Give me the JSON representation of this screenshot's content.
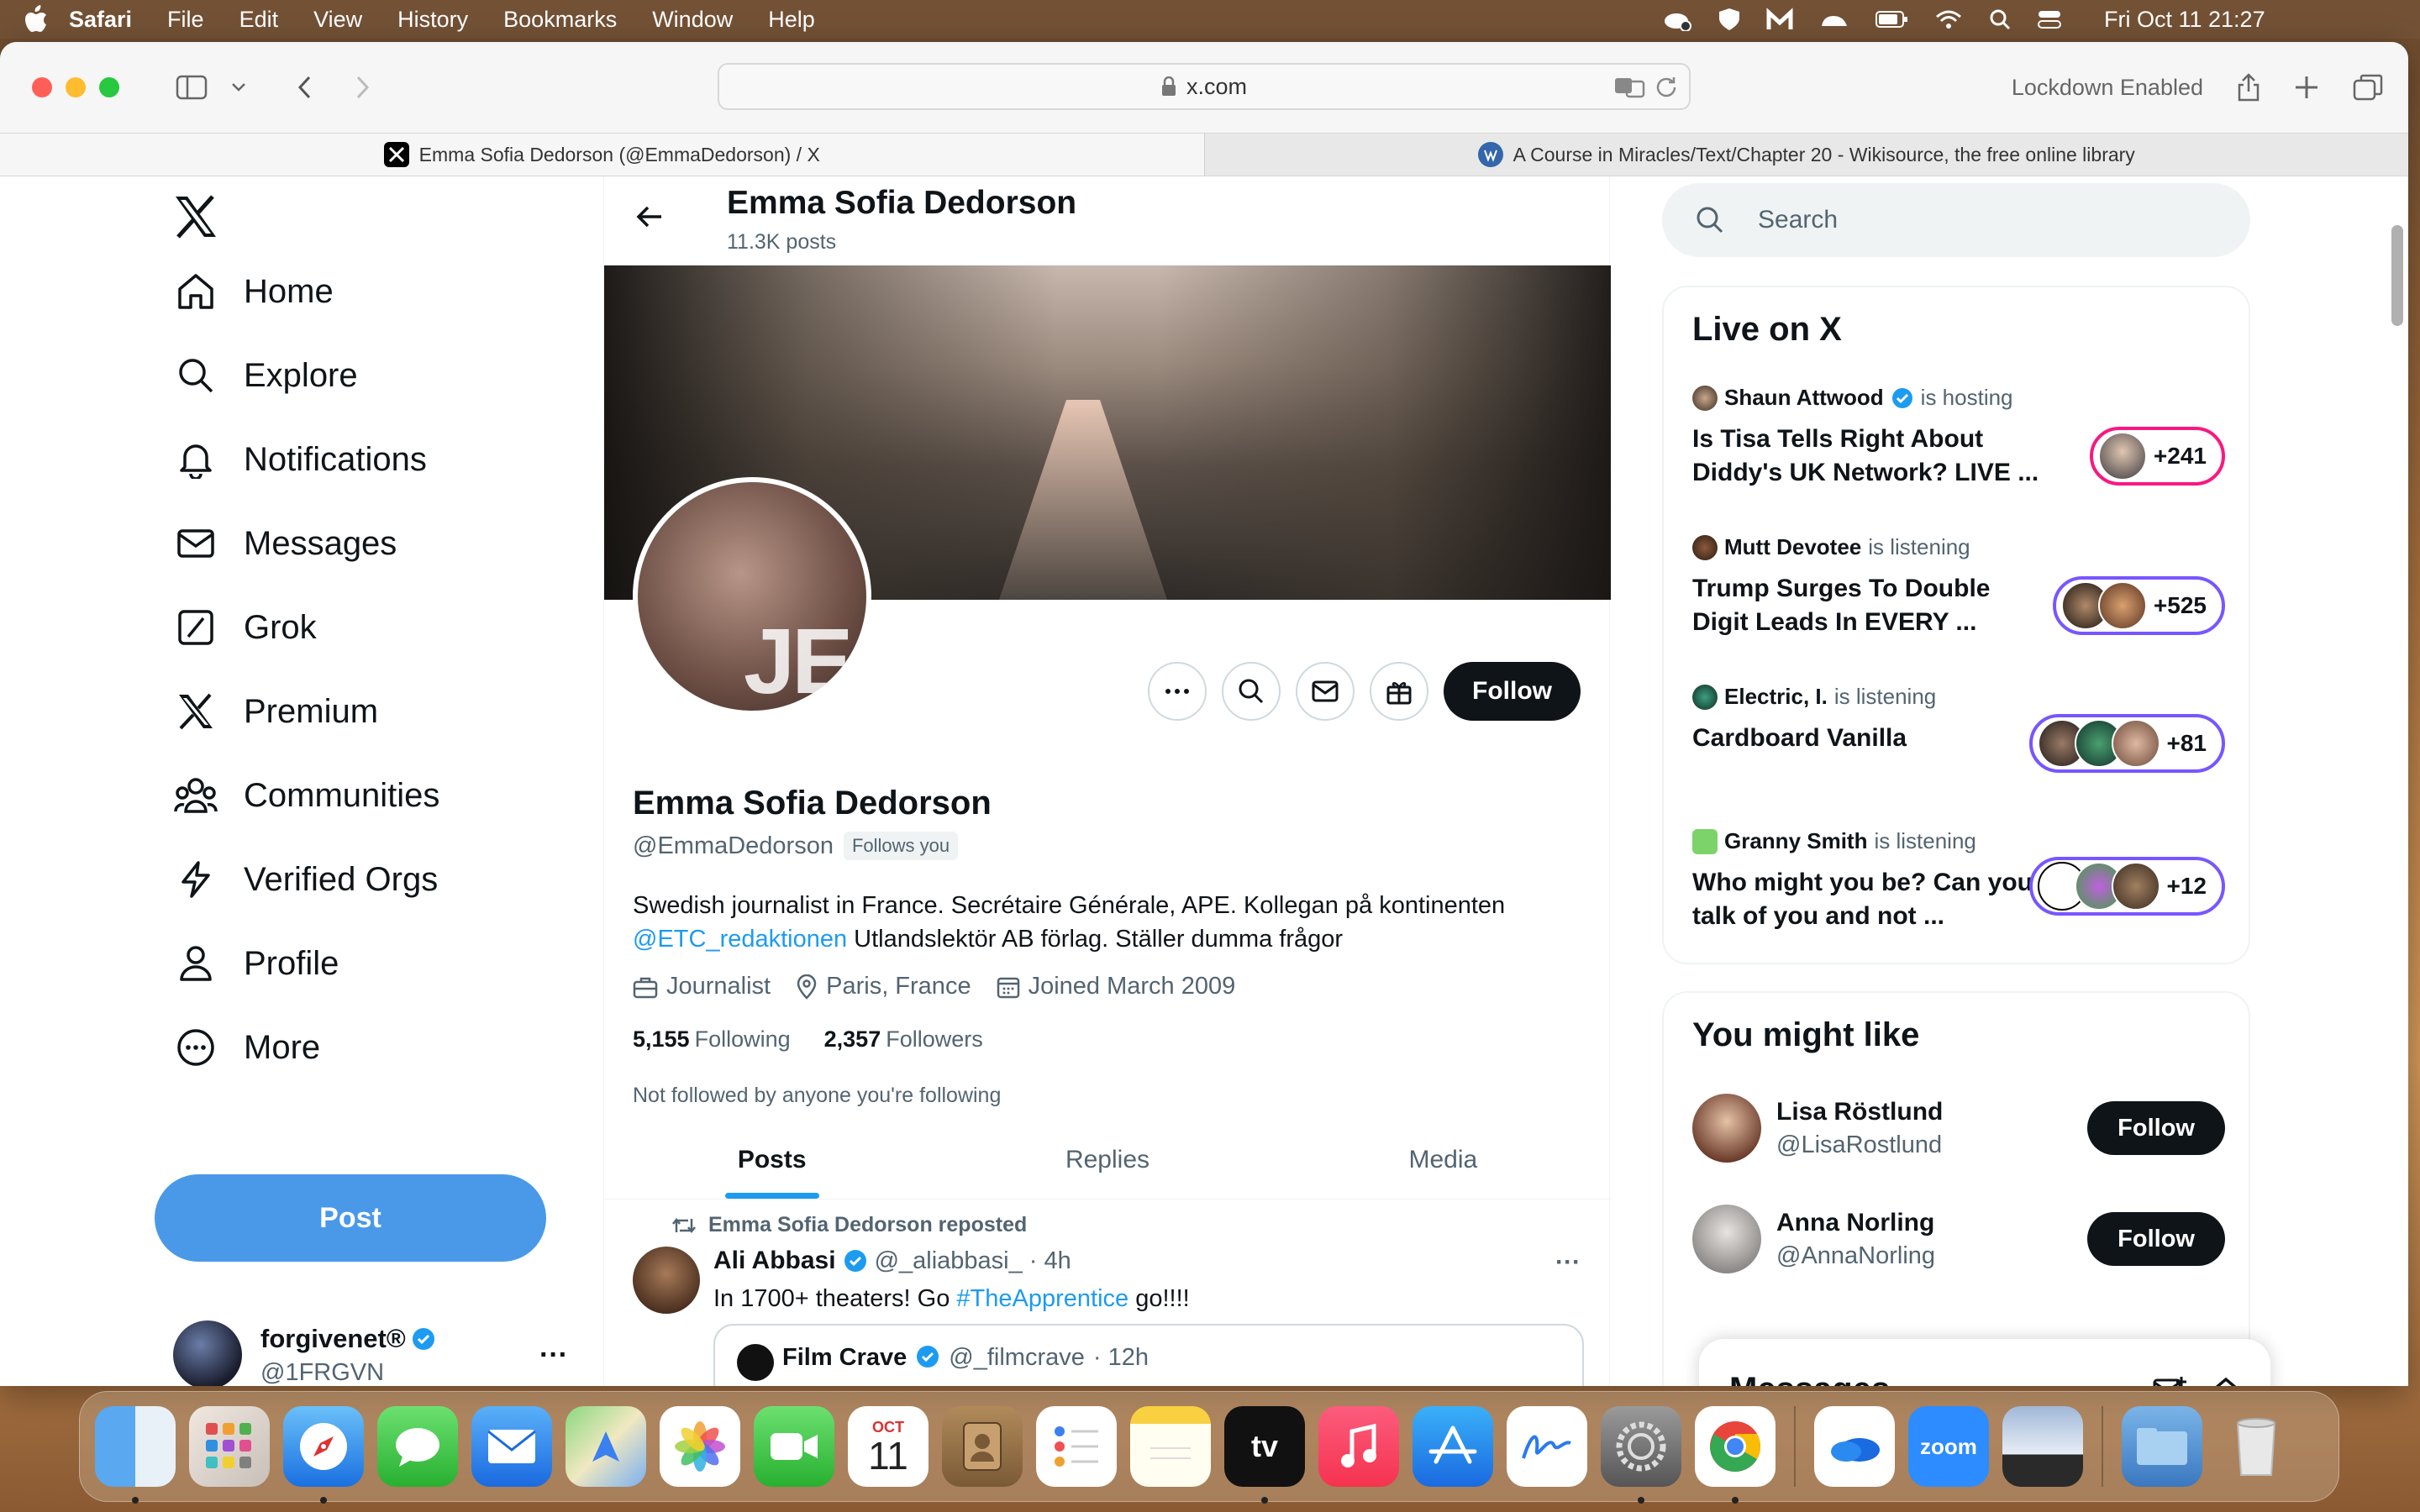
{
  "menubar": {
    "app": "Safari",
    "items": [
      "File",
      "Edit",
      "View",
      "History",
      "Bookmarks",
      "Window",
      "Help"
    ],
    "clock": "Fri Oct 11  21:27"
  },
  "browser": {
    "url": "x.com",
    "lockdown": "Lockdown Enabled",
    "tabs": [
      {
        "title": "Emma Sofia Dedorson (@EmmaDedorson) / X",
        "icon": "x-logo-icon",
        "active": true
      },
      {
        "title": "A Course in Miracles/Text/Chapter 20 - Wikisource, the free online library",
        "icon": "wikisource-icon",
        "active": false
      }
    ]
  },
  "nav": {
    "items": [
      {
        "label": "Home",
        "icon": "home-icon"
      },
      {
        "label": "Explore",
        "icon": "search-icon"
      },
      {
        "label": "Notifications",
        "icon": "bell-icon"
      },
      {
        "label": "Messages",
        "icon": "envelope-icon"
      },
      {
        "label": "Grok",
        "icon": "grok-icon"
      },
      {
        "label": "Premium",
        "icon": "x-logo-icon"
      },
      {
        "label": "Communities",
        "icon": "people-icon"
      },
      {
        "label": "Verified Orgs",
        "icon": "lightning-icon"
      },
      {
        "label": "Profile",
        "icon": "person-icon"
      },
      {
        "label": "More",
        "icon": "more-circle-icon"
      }
    ],
    "post_label": "Post",
    "account": {
      "name": "forgivenet®",
      "handle": "@1FRGVN"
    }
  },
  "profile": {
    "header_name": "Emma Sofia Dedorson",
    "post_count": "11.3K posts",
    "pic_text": "JE",
    "name": "Emma Sofia Dedorson",
    "handle": "@EmmaDedorson",
    "follows_you": "Follows you",
    "follow_label": "Follow",
    "bio_line1": "Swedish journalist in France. Secrétaire Générale, APE. Kollegan på kontinenten",
    "bio_link": "@ETC_redaktionen",
    "bio_line2": " Utlandslektör AB förlag. Ställer dumma frågor",
    "job": "Journalist",
    "location": "Paris, France",
    "joined": "Joined March 2009",
    "following_count": "5,155",
    "following_label": "Following",
    "followers_count": "2,357",
    "followers_label": "Followers",
    "not_followed": "Not followed by anyone you're following",
    "tabs": [
      "Posts",
      "Replies",
      "Media"
    ]
  },
  "tweet": {
    "repost_label": "Emma Sofia Dedorson reposted",
    "author": "Ali Abbasi",
    "handle": "@_aliabbasi_",
    "time": "· 4h",
    "text_before": "In 1700+ theaters! Go ",
    "hashtag": "#TheApprentice",
    "text_after": " go!!!!",
    "quote_author": "Film Crave",
    "quote_handle": "@_filmcrave",
    "quote_time": "· 12h"
  },
  "sidebar": {
    "search_placeholder": "Search",
    "live_title": "Live on X",
    "live": [
      {
        "host": "Shaun Attwood",
        "status": "is hosting",
        "verified": true,
        "title": "Is Tisa Tells Right About Diddy's UK Network? LIVE ...",
        "count": "+241",
        "accent": "#f91880"
      },
      {
        "host": "Mutt Devotee",
        "status": "is listening",
        "verified": false,
        "title": "Trump Surges To Double Digit Leads In EVERY ...",
        "count": "+525",
        "accent": "#7856ff"
      },
      {
        "host": "Electric, I.",
        "status": "is listening",
        "verified": false,
        "title": "Cardboard Vanilla",
        "count": "+81",
        "accent": "#7856ff"
      },
      {
        "host": "Granny Smith",
        "status": "is listening",
        "verified": false,
        "title": "Who might you be? Can you talk of you and not ...",
        "count": "+12",
        "accent": "#7856ff"
      }
    ],
    "like_title": "You might like",
    "suggestions": [
      {
        "name": "Lisa Röstlund",
        "handle": "@LisaRostlund",
        "button": "Follow"
      },
      {
        "name": "Anna Norling",
        "handle": "@AnnaNorling",
        "button": "Follow"
      }
    ],
    "messages_title": "Messages"
  },
  "dock": {
    "calendar_month": "OCT",
    "calendar_day": "11",
    "tv_label": "tv",
    "zoom_label": "zoom"
  },
  "colors": {
    "accent_blue": "#1d9bf0",
    "post_button": "#4a99e9",
    "live_hosting": "#f91880",
    "live_listening": "#7856ff"
  }
}
